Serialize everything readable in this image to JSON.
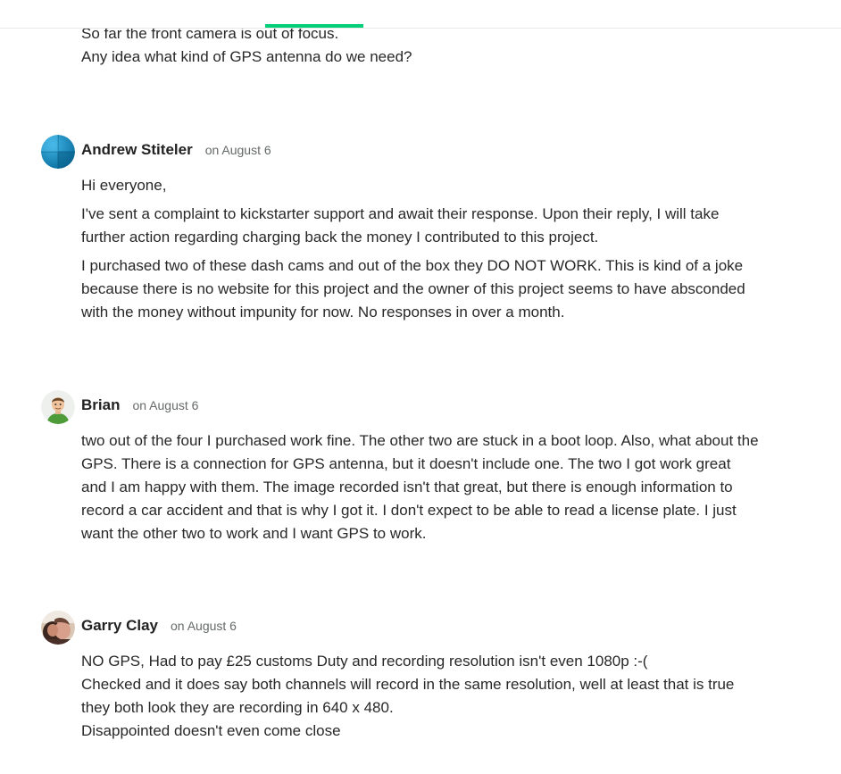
{
  "leading_comment": {
    "lines": [
      "So far the front camera is out of focus.",
      "Any idea what kind of GPS antenna do we need?"
    ]
  },
  "comments": [
    {
      "author": "Andrew Stiteler",
      "date": "on August 6",
      "avatar_icon": "blue-sphere-avatar-icon",
      "paragraphs": [
        [
          "Hi everyone,"
        ],
        [
          "I've sent a complaint to kickstarter support and await their response. Upon their reply, I will take",
          "further action regarding charging back the money I contributed to this project."
        ],
        [
          "I purchased two of these dash cams and out of the box they DO NOT WORK. This is kind of a joke",
          "because there is no website for this project and the owner of this project seems to have absconded",
          "with the money without impunity for now. No responses in over a month."
        ]
      ]
    },
    {
      "author": "Brian",
      "date": "on August 6",
      "avatar_icon": "cartoon-man-avatar-icon",
      "paragraphs": [
        [
          "two out of the four I purchased work fine. The other two are stuck in a boot loop. Also, what about the",
          "GPS. There is a connection for GPS antenna, but it doesn't include one. The two I got work great",
          "and I am happy with them. The image recorded isn't that great, but there is enough information to",
          "record a car accident and that is why I got it. I don't expect to be able to read a license plate. I just",
          "want the other two to work and I want GPS to work."
        ]
      ]
    },
    {
      "author": "Garry Clay",
      "date": "on August 6",
      "avatar_icon": "photo-avatar-icon",
      "paragraphs": [
        [
          "NO GPS, Had to pay £25 customs Duty and recording resolution isn't even 1080p :-(",
          "Checked and it does say both channels will record in the same resolution, well at least that is true",
          "they both look they are recording in 640 x 480.",
          "Disappointed doesn't even come close"
        ]
      ]
    }
  ],
  "colors": {
    "accent_green": "#05ce78",
    "text": "#282828",
    "date_grey": "#656969"
  }
}
